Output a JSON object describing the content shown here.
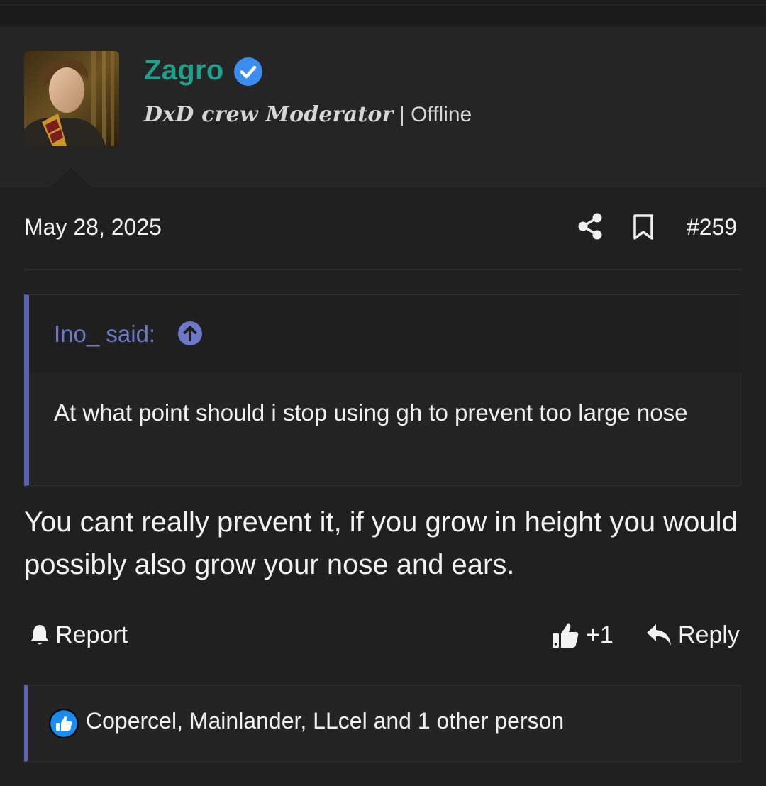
{
  "post": {
    "author": {
      "name": "Zagro",
      "title_styled": "DxD crew Moderator",
      "title_separator": " | ",
      "status": "Offline",
      "avatar_icon": "user-avatar-photo",
      "verified_icon": "verified-check-icon",
      "name_color": "#1f9f8c"
    },
    "date": "May 28, 2025",
    "number": "#259",
    "quote": {
      "author_label": "Ino_ said:",
      "text": "At what point should i stop using gh to prevent too large nose",
      "accent_color": "#5b63b7"
    },
    "body": "You cant really prevent it, if you grow in height you would possibly also grow your nose and ears.",
    "actions": {
      "report_label": "Report",
      "reaction_count": "+1",
      "reply_label": "Reply"
    },
    "reactions": {
      "names": "Copercel, Mainlander, LLcel and 1 other person"
    }
  }
}
